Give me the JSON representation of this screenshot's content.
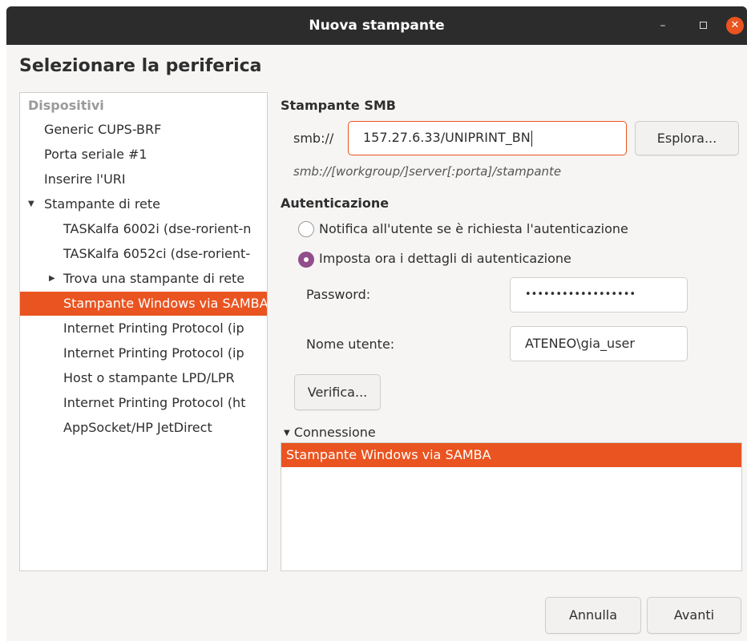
{
  "window": {
    "title": "Nuova stampante"
  },
  "heading": "Selezionare la periferica",
  "devices": {
    "header": "Dispositivi",
    "items": [
      {
        "label": "Generic CUPS-BRF"
      },
      {
        "label": "Porta seriale #1"
      },
      {
        "label": "Inserire l'URI"
      },
      {
        "label": "Stampante di rete"
      },
      {
        "label": "TASKalfa 6002i (dse-rorient-n"
      },
      {
        "label": "TASKalfa 6052ci (dse-rorient-"
      },
      {
        "label": "Trova una stampante di rete"
      },
      {
        "label": "Stampante Windows via SAMBA"
      },
      {
        "label": "Internet Printing Protocol (ip"
      },
      {
        "label": "Internet Printing Protocol (ip"
      },
      {
        "label": "Host o stampante LPD/LPR"
      },
      {
        "label": "Internet Printing Protocol (ht"
      },
      {
        "label": "AppSocket/HP JetDirect"
      }
    ]
  },
  "smb": {
    "section_title": "Stampante SMB",
    "prefix": "smb://",
    "uri_value": "157.27.6.33/UNIPRINT_BN",
    "browse_label": "Esplora...",
    "hint": "smb://[workgroup/]server[:porta]/stampante"
  },
  "auth": {
    "section_title": "Autenticazione",
    "option_notify": "Notifica all'utente se è richiesta l'autenticazione",
    "option_now": "Imposta ora i dettagli di autenticazione",
    "password_label": "Password:",
    "password_value": "••••••••••••••••••",
    "username_label": "Nome utente:",
    "username_value": "ATENEO\\gia_user",
    "verify_label": "Verifica..."
  },
  "connection": {
    "title": "Connessione",
    "items": [
      "Stampante Windows via SAMBA"
    ]
  },
  "footer": {
    "cancel_label": "Annulla",
    "next_label": "Avanti"
  },
  "colors": {
    "accent": "#e95420",
    "radio_selected": "#924d8b",
    "titlebar": "#2c2c2c"
  }
}
